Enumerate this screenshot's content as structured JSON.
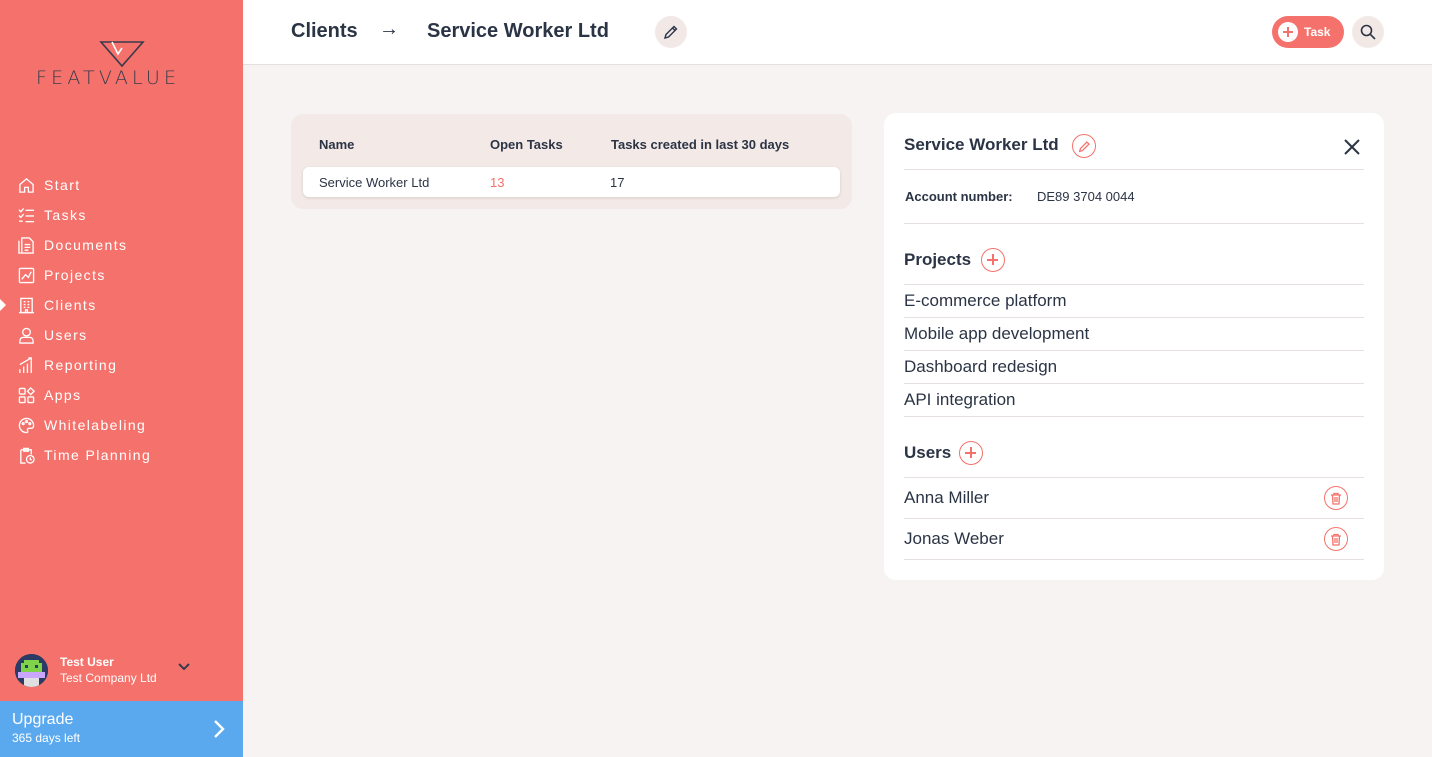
{
  "brand": {
    "name": "FEATVALUE",
    "accent": "#f4726b",
    "upgrade_color": "#5aa9ef"
  },
  "sidebar": {
    "items": [
      {
        "label": "Start",
        "icon": "home-icon"
      },
      {
        "label": "Tasks",
        "icon": "tasks-icon"
      },
      {
        "label": "Documents",
        "icon": "documents-icon"
      },
      {
        "label": "Projects",
        "icon": "projects-icon"
      },
      {
        "label": "Clients",
        "icon": "clients-icon",
        "active": true
      },
      {
        "label": "Users",
        "icon": "user-icon"
      },
      {
        "label": "Reporting",
        "icon": "reporting-icon"
      },
      {
        "label": "Apps",
        "icon": "apps-icon"
      },
      {
        "label": "Whitelabeling",
        "icon": "palette-icon"
      },
      {
        "label": "Time Planning",
        "icon": "time-planning-icon"
      }
    ],
    "user": {
      "name": "Test User",
      "company": "Test Company Ltd"
    },
    "upgrade": {
      "title": "Upgrade",
      "subtitle": "365 days left"
    }
  },
  "header": {
    "breadcrumb_root": "Clients",
    "breadcrumb_arrow": "→",
    "breadcrumb_current": "Service Worker Ltd",
    "task_button": "Task"
  },
  "table": {
    "columns": [
      "Name",
      "Open Tasks",
      "Tasks created in last 30 days"
    ],
    "rows": [
      {
        "name": "Service Worker Ltd",
        "open_tasks": "13",
        "tasks_30d": "17"
      }
    ]
  },
  "detail": {
    "title": "Service Worker Ltd",
    "account_label": "Account number:",
    "account_number": "DE89 3704 0044",
    "projects_title": "Projects",
    "projects": [
      "E-commerce platform",
      "Mobile app development",
      "Dashboard redesign",
      "API integration"
    ],
    "users_title": "Users",
    "users": [
      "Anna Miller",
      "Jonas Weber"
    ]
  }
}
